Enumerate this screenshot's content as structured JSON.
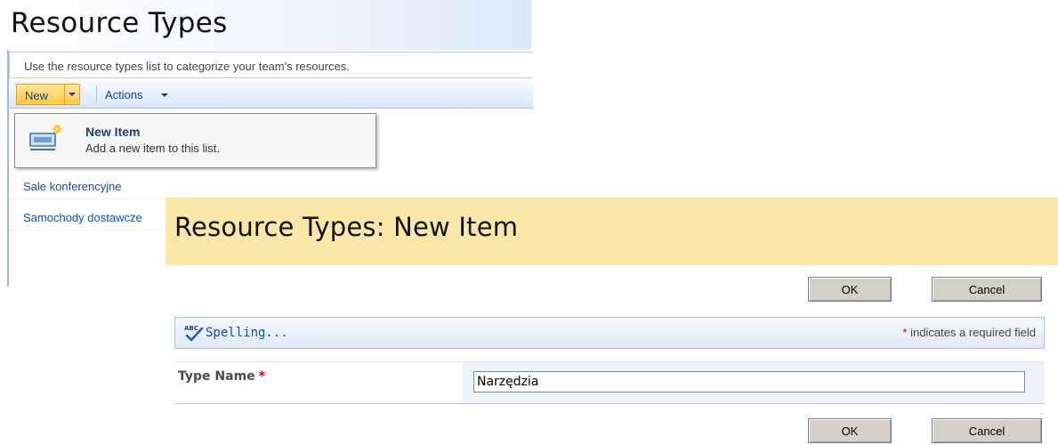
{
  "list_view": {
    "page_title": "Resource Types",
    "description": "Use the resource types list to categorize your team's resources.",
    "toolbar": {
      "new_label": "New",
      "actions_label": "Actions"
    },
    "new_menu": {
      "item_title": "New Item",
      "item_description": "Add a new item to this list.",
      "icon": "new-item-icon"
    },
    "items": [
      "Sale konferencyjne",
      "Samochody dostawcze"
    ]
  },
  "form": {
    "title": "Resource Types: New Item",
    "ok_label": "OK",
    "cancel_label": "Cancel",
    "spelling_label": "Spelling...",
    "required_star": "*",
    "required_note": " indicates a required field",
    "field_label": "Type Name",
    "field_required": "*",
    "type_name_value": "Narzędzia"
  },
  "colors": {
    "form_header_bg": "#fce7a9",
    "link_blue": "#0b4fa3",
    "required_red": "#e00000",
    "new_button_gold": "#ffc942"
  }
}
